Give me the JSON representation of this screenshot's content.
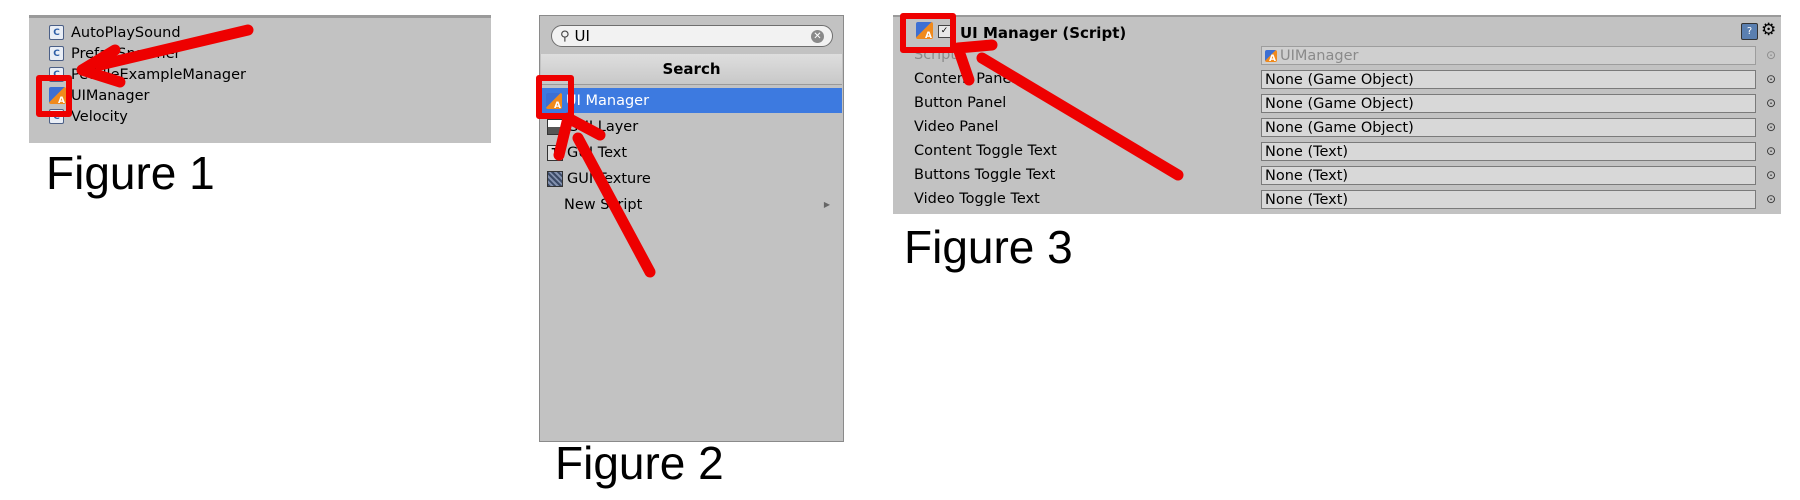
{
  "figure1": {
    "caption": "Figure 1",
    "items": [
      "AutoPlaySound",
      "PrefabSpawner",
      "PeddleExampleManager",
      "UIManager",
      "Velocity"
    ]
  },
  "figure2": {
    "caption": "Figure 2",
    "search": {
      "value": "UI",
      "placeholder": ""
    },
    "header": "Search",
    "items": [
      {
        "label": "UI Manager",
        "icon": "ui-script-icon",
        "selected": true
      },
      {
        "label": "GUI Layer",
        "icon": "gui-layer-icon"
      },
      {
        "label": "GUI Text",
        "icon": "gui-text-icon"
      },
      {
        "label": "GUI Texture",
        "icon": "gui-texture-icon"
      },
      {
        "label": "New Script",
        "icon": ""
      }
    ]
  },
  "figure3": {
    "caption": "Figure 3",
    "title": "UI Manager (Script)",
    "rows": [
      {
        "label": "Script",
        "value": "UIManager",
        "dim": true
      },
      {
        "label": "Content Panel",
        "value": "None (Game Object)"
      },
      {
        "label": "Button Panel",
        "value": "None (Game Object)"
      },
      {
        "label": "Video Panel",
        "value": "None (Game Object)"
      },
      {
        "label": "Content Toggle Text",
        "value": "None (Text)"
      },
      {
        "label": "Buttons Toggle Text",
        "value": "None (Text)"
      },
      {
        "label": "Video Toggle Text",
        "value": "None (Text)"
      }
    ]
  },
  "colors": {
    "panel": "#c2c2c2",
    "selection": "#3d7ae0",
    "annotation_red": "#ee0000"
  }
}
